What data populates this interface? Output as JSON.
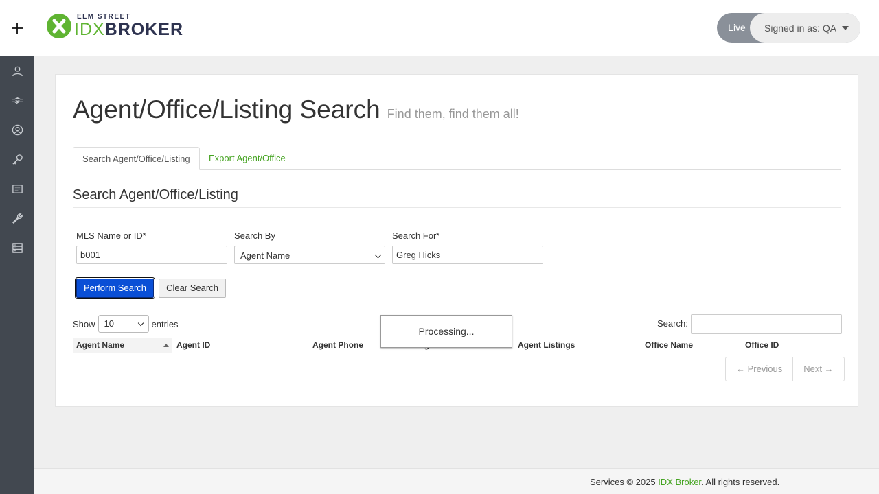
{
  "header": {
    "logo_top": "ELM STREET",
    "logo_idx": "IDX",
    "logo_broker": "BROKER",
    "env_badge": "Live",
    "signed_in": "Signed in as: QA"
  },
  "sidebar": {
    "items": [
      {
        "icon": "user-icon"
      },
      {
        "icon": "handshake-icon"
      },
      {
        "icon": "account-circle-icon"
      },
      {
        "icon": "key-icon"
      },
      {
        "icon": "newspaper-icon"
      },
      {
        "icon": "wrench-icon"
      },
      {
        "icon": "server-icon"
      }
    ]
  },
  "page": {
    "title": "Agent/Office/Listing Search",
    "subtitle": "Find them, find them all!"
  },
  "tabs": [
    {
      "label": "Search Agent/Office/Listing",
      "active": true
    },
    {
      "label": "Export Agent/Office",
      "active": false
    }
  ],
  "section": {
    "title": "Search Agent/Office/Listing"
  },
  "form": {
    "mls_label": "MLS Name or ID*",
    "mls_value": "b001",
    "search_by_label": "Search By",
    "search_by_value": "Agent Name",
    "search_for_label": "Search For*",
    "search_for_value": "Greg Hicks",
    "perform_label": "Perform Search",
    "clear_label": "Clear Search"
  },
  "table": {
    "show_label": "Show",
    "page_size": "10",
    "entries_label": "entries",
    "search_label": "Search:",
    "search_value": "",
    "columns": [
      "Agent Name",
      "Agent ID",
      "Agent Phone",
      "Agent Email",
      "Agent Listings",
      "Office Name",
      "Office ID"
    ],
    "sorted_column": "Agent Name",
    "processing": "Processing...",
    "prev_label": "← Previous",
    "next_label": "Next →"
  },
  "footer": {
    "prefix": "Services © 2025 ",
    "brand": "IDX Broker",
    "suffix": ". All rights reserved."
  },
  "colors": {
    "rail_bg": "#424850",
    "brand_green": "#5fb432",
    "link_green": "#44a320",
    "primary_button": "#0a4fd6"
  }
}
